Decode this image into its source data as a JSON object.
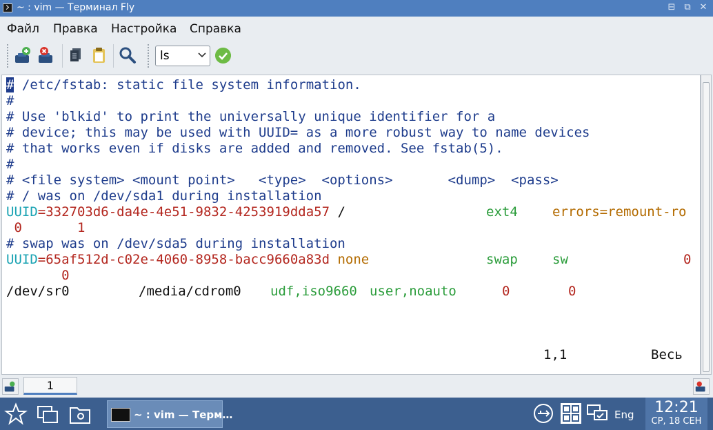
{
  "window": {
    "title": "~ : vim — Терминал Fly",
    "buttons": {
      "minimize": "⊟",
      "restore": "⧉",
      "close": "✕"
    }
  },
  "menu": [
    "Файл",
    "Правка",
    "Настройка",
    "Справка"
  ],
  "toolbar": {
    "command_value": "ls",
    "icons": [
      "new-session-icon",
      "close-session-icon",
      "copy-icon",
      "paste-icon",
      "find-icon",
      "run-icon"
    ]
  },
  "terminal": {
    "lines": [
      {
        "cursor": "#",
        "text": " /etc/fstab: static file system information."
      },
      {
        "text": "#"
      },
      {
        "text": "# Use 'blkid' to print the universally unique identifier for a"
      },
      {
        "text": "# device; this may be used with UUID= as a more robust way to name devices"
      },
      {
        "text": "# that works even if disks are added and removed. See fstab(5)."
      },
      {
        "text": "#"
      },
      {
        "text": "# <file system> <mount point>   <type>  <options>       <dump>  <pass>"
      },
      {
        "text": "# / was on /dev/sda1 during installation"
      },
      {
        "uuid": "UUID",
        "eq": "=",
        "id": "332703d6-da4e-4e51-9832-4253919dda57",
        "mount": " /",
        "type": "ext4",
        "opts": "errors=remount-ro"
      },
      {
        "cont": " 0       1"
      },
      {
        "text": "# swap was on /dev/sda5 during installation"
      },
      {
        "uuid": "UUID",
        "eq": "=",
        "id": "65af512d-c02e-4060-8958-bacc9660a83d",
        "mount": " none",
        "type": "swap",
        "opts": "sw",
        "dump": "0"
      },
      {
        "cont": "       0"
      },
      {
        "dev": "/dev/sr0",
        "mount": "/media/cdrom0",
        "type": "udf,iso9660",
        "opts": "user,noauto",
        "dump": "0",
        "pass": "0"
      }
    ],
    "status": {
      "position": "1,1",
      "scroll": "Весь"
    }
  },
  "tabs": [
    "1"
  ],
  "taskbar": {
    "task_label": "~ : vim — Терм…",
    "lang": "Eng",
    "time": "12:21",
    "date": "СР, 18 СЕН"
  },
  "colors": {
    "titlebar": "#4f7fbf",
    "taskbar": "#3c5f8f",
    "comment": "#1e3c8c",
    "uuid_key": "#1aa3b3",
    "value": "#b3261e",
    "type": "#2a9c3a",
    "option": "#b36b00"
  }
}
